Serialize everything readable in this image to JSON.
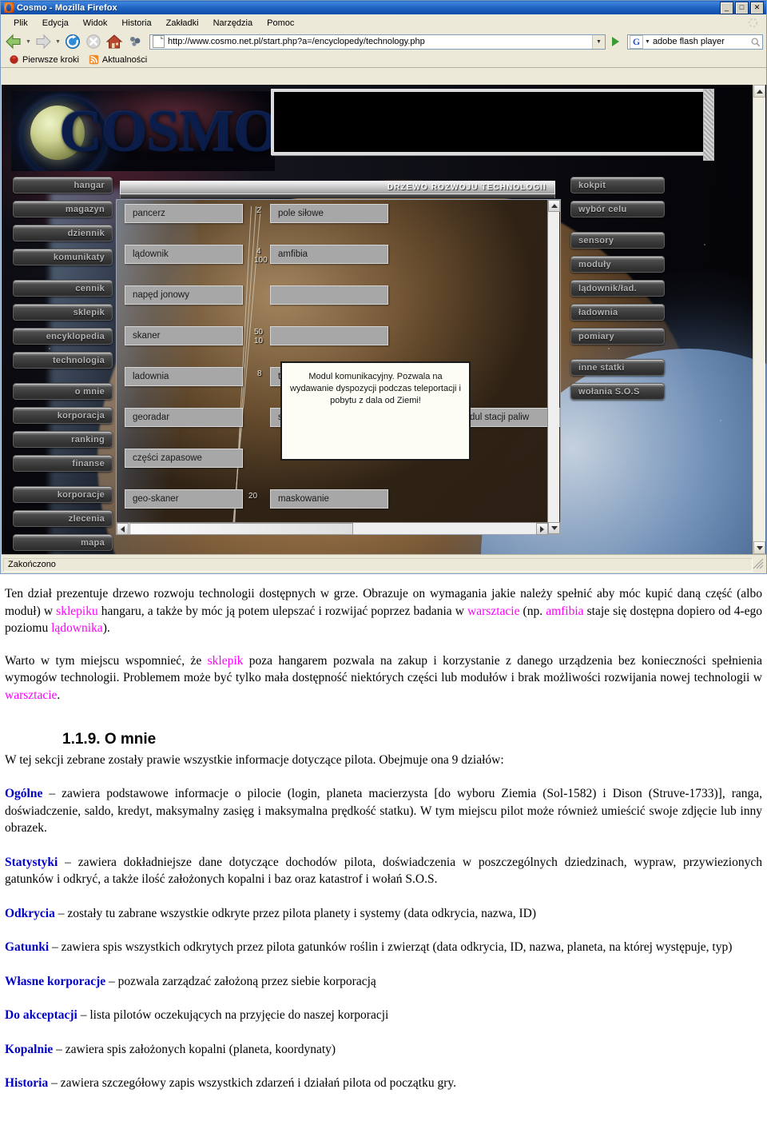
{
  "browser": {
    "window_title": "Cosmo - Mozilla Firefox",
    "window_buttons": {
      "minimize": "_",
      "maximize": "□",
      "close": "✕"
    },
    "menu": [
      {
        "label": "Plik"
      },
      {
        "label": "Edycja"
      },
      {
        "label": "Widok"
      },
      {
        "label": "Historia"
      },
      {
        "label": "Zakładki"
      },
      {
        "label": "Narzędzia"
      },
      {
        "label": "Pomoc"
      }
    ],
    "toolbar": {
      "back_icon": "back-arrow-icon",
      "forward_icon": "forward-arrow-icon",
      "reload_icon": "reload-icon",
      "stop_icon": "stop-icon",
      "home_icon": "home-icon",
      "extension_icon": "extension-icon"
    },
    "url": "http://www.cosmo.net.pl/start.php?a=/encyclopedy/technology.php",
    "search": {
      "engine": "G",
      "query": "adobe flash player"
    },
    "bookmarks": [
      {
        "label": "Pierwsze kroki",
        "icon": "firefox-bookmark-icon"
      },
      {
        "label": "Aktualności",
        "icon": "rss-feed-icon"
      }
    ],
    "status": "Zakończono"
  },
  "game": {
    "logo": "COSMO",
    "panel_title": "DRZEWO ROZWOJU TECHNOLOGII",
    "left_menu": [
      {
        "label": "hangar"
      },
      {
        "label": "magazyn"
      },
      {
        "label": "dziennik"
      },
      {
        "label": "komunikaty"
      },
      {
        "label": "cennik"
      },
      {
        "label": "sklepik"
      },
      {
        "label": "encyklopedia"
      },
      {
        "label": "technologia"
      },
      {
        "label": "o mnie"
      },
      {
        "label": "korporacja"
      },
      {
        "label": "ranking"
      },
      {
        "label": "finanse"
      },
      {
        "label": "korporacje"
      },
      {
        "label": "zlecenia"
      },
      {
        "label": "mapa"
      }
    ],
    "right_menu": [
      {
        "label": "kokpit"
      },
      {
        "label": "wybór celu"
      },
      {
        "label": "sensory"
      },
      {
        "label": "moduły"
      },
      {
        "label": "lądownik/ład."
      },
      {
        "label": "ładownia"
      },
      {
        "label": "pomiary"
      },
      {
        "label": "inne statki"
      },
      {
        "label": "wołania S.O.S"
      }
    ],
    "tech_nodes": [
      {
        "label": "pancerz",
        "col": 0,
        "row": 0
      },
      {
        "label": "lądownik",
        "col": 0,
        "row": 1
      },
      {
        "label": "napęd jonowy",
        "col": 0,
        "row": 2
      },
      {
        "label": "skaner",
        "col": 0,
        "row": 3
      },
      {
        "label": "ladownia",
        "col": 0,
        "row": 4
      },
      {
        "label": "georadar",
        "col": 0,
        "row": 5
      },
      {
        "label": "części zapasowe",
        "col": 0,
        "row": 6
      },
      {
        "label": "geo-skaner",
        "col": 0,
        "row": 7
      },
      {
        "label": "pole siłowe",
        "col": 1,
        "row": 0
      },
      {
        "label": "amfibia",
        "col": 1,
        "row": 1
      },
      {
        "label": "teleporter materii",
        "col": 1,
        "row": 4
      },
      {
        "label": "syntezator geopaliwa",
        "col": 1,
        "row": 5
      },
      {
        "label": "maskowanie",
        "col": 1,
        "row": 7
      },
      {
        "label": "modul stacji paliw",
        "col": 2,
        "row": 5
      }
    ],
    "edge_labels": [
      "2",
      "4",
      "100",
      "50",
      "10",
      "8",
      "2",
      "20"
    ],
    "tooltip": "Modul komunikacyjny. Pozwala na wydawanie dyspozycji podczas teleportacji i pobytu z dala od Ziemi!"
  },
  "document": {
    "para1": {
      "t1": "Ten dział prezentuje drzewo rozwoju technologii dostępnych w grze. Obrazuje on wymagania jakie należy spełnić aby móc kupić daną część (albo moduł) w ",
      "l1": "sklepiku",
      "t2": " hangaru, a także by móc ją potem ulepszać i rozwijać poprzez badania w ",
      "l2": "warsztacie",
      "t3": " (np. ",
      "l3": "amfibia",
      "t4": " staje się dostępna dopiero od 4-ego poziomu ",
      "l4": "lądownika",
      "t5": ")."
    },
    "para2": {
      "t1": "Warto w tym miejscu wspomnieć, że ",
      "l1": "sklepik",
      "t2": " poza hangarem pozwala na zakup i korzystanie z danego urządzenia bez konieczności spełnienia wymogów technologii. Problemem może być tylko mała dostępność niektórych części lub modułów i brak możliwości rozwijania nowej technologii w ",
      "l2": "warsztacie",
      "t3": "."
    },
    "heading": "1.1.9. O mnie",
    "intro": "W tej sekcji zebrane zostały prawie wszystkie informacje dotyczące pilota. Obejmuje ona 9 działów:",
    "sections": [
      {
        "term": "Ogólne",
        "body": " – zawiera podstawowe informacje o pilocie (login, planeta macierzysta [do wyboru Ziemia (Sol-1582) i Dison (Struve-1733)], ranga, doświadczenie, saldo, kredyt, maksymalny zasięg i maksymalna prędkość statku). W tym miejscu pilot może również umieścić swoje zdjęcie lub inny obrazek."
      },
      {
        "term": "Statystyki",
        "body": " – zawiera dokładniejsze dane dotyczące dochodów pilota, doświadczenia w poszczególnych dziedzinach, wypraw, przywiezionych gatunków i odkryć, a także ilość założonych kopalni i baz oraz katastrof i wołań S.O.S."
      },
      {
        "term": "Odkrycia",
        "body": " – zostały tu zabrane wszystkie odkryte przez pilota planety i systemy (data odkrycia, nazwa, ID)"
      },
      {
        "term": "Gatunki",
        "body": " – zawiera spis wszystkich odkrytych przez pilota gatunków roślin i zwierząt (data odkrycia, ID, nazwa, planeta, na której występuje, typ)"
      },
      {
        "term": "Własne korporacje",
        "body": " – pozwala zarządzać założoną przez siebie korporacją"
      },
      {
        "term": "Do akceptacji",
        "body": " – lista pilotów oczekujących na przyjęcie do naszej korporacji"
      },
      {
        "term": "Kopalnie",
        "body": " – zawiera spis założonych kopalni (planeta, koordynaty)"
      },
      {
        "term": "Historia",
        "body": " – zawiera szczegółowy zapis wszystkich zdarzeń i działań pilota od początku gry."
      }
    ]
  },
  "colors": {
    "link_magenta": "#ff00ff",
    "term_blue": "#0000c8",
    "titlebar_blue": "#1f63c0",
    "chrome_beige": "#ece9d8"
  }
}
